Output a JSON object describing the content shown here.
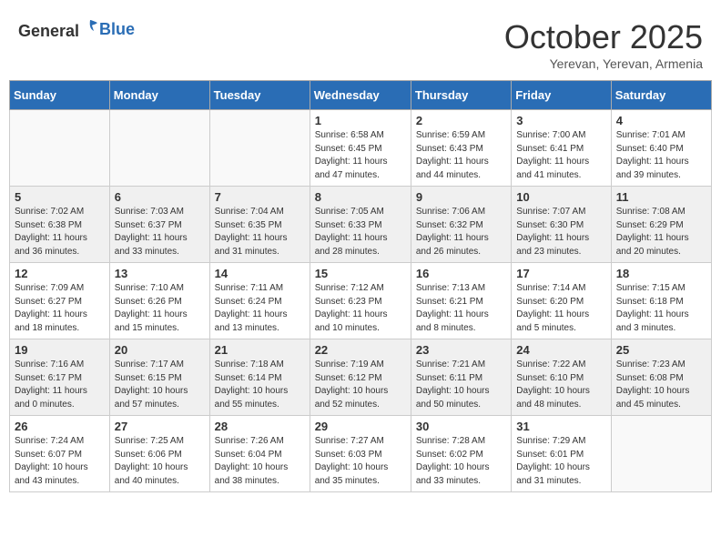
{
  "header": {
    "logo_general": "General",
    "logo_blue": "Blue",
    "month": "October 2025",
    "location": "Yerevan, Yerevan, Armenia"
  },
  "weekdays": [
    "Sunday",
    "Monday",
    "Tuesday",
    "Wednesday",
    "Thursday",
    "Friday",
    "Saturday"
  ],
  "weeks": [
    [
      {
        "day": "",
        "info": ""
      },
      {
        "day": "",
        "info": ""
      },
      {
        "day": "",
        "info": ""
      },
      {
        "day": "1",
        "info": "Sunrise: 6:58 AM\nSunset: 6:45 PM\nDaylight: 11 hours\nand 47 minutes."
      },
      {
        "day": "2",
        "info": "Sunrise: 6:59 AM\nSunset: 6:43 PM\nDaylight: 11 hours\nand 44 minutes."
      },
      {
        "day": "3",
        "info": "Sunrise: 7:00 AM\nSunset: 6:41 PM\nDaylight: 11 hours\nand 41 minutes."
      },
      {
        "day": "4",
        "info": "Sunrise: 7:01 AM\nSunset: 6:40 PM\nDaylight: 11 hours\nand 39 minutes."
      }
    ],
    [
      {
        "day": "5",
        "info": "Sunrise: 7:02 AM\nSunset: 6:38 PM\nDaylight: 11 hours\nand 36 minutes."
      },
      {
        "day": "6",
        "info": "Sunrise: 7:03 AM\nSunset: 6:37 PM\nDaylight: 11 hours\nand 33 minutes."
      },
      {
        "day": "7",
        "info": "Sunrise: 7:04 AM\nSunset: 6:35 PM\nDaylight: 11 hours\nand 31 minutes."
      },
      {
        "day": "8",
        "info": "Sunrise: 7:05 AM\nSunset: 6:33 PM\nDaylight: 11 hours\nand 28 minutes."
      },
      {
        "day": "9",
        "info": "Sunrise: 7:06 AM\nSunset: 6:32 PM\nDaylight: 11 hours\nand 26 minutes."
      },
      {
        "day": "10",
        "info": "Sunrise: 7:07 AM\nSunset: 6:30 PM\nDaylight: 11 hours\nand 23 minutes."
      },
      {
        "day": "11",
        "info": "Sunrise: 7:08 AM\nSunset: 6:29 PM\nDaylight: 11 hours\nand 20 minutes."
      }
    ],
    [
      {
        "day": "12",
        "info": "Sunrise: 7:09 AM\nSunset: 6:27 PM\nDaylight: 11 hours\nand 18 minutes."
      },
      {
        "day": "13",
        "info": "Sunrise: 7:10 AM\nSunset: 6:26 PM\nDaylight: 11 hours\nand 15 minutes."
      },
      {
        "day": "14",
        "info": "Sunrise: 7:11 AM\nSunset: 6:24 PM\nDaylight: 11 hours\nand 13 minutes."
      },
      {
        "day": "15",
        "info": "Sunrise: 7:12 AM\nSunset: 6:23 PM\nDaylight: 11 hours\nand 10 minutes."
      },
      {
        "day": "16",
        "info": "Sunrise: 7:13 AM\nSunset: 6:21 PM\nDaylight: 11 hours\nand 8 minutes."
      },
      {
        "day": "17",
        "info": "Sunrise: 7:14 AM\nSunset: 6:20 PM\nDaylight: 11 hours\nand 5 minutes."
      },
      {
        "day": "18",
        "info": "Sunrise: 7:15 AM\nSunset: 6:18 PM\nDaylight: 11 hours\nand 3 minutes."
      }
    ],
    [
      {
        "day": "19",
        "info": "Sunrise: 7:16 AM\nSunset: 6:17 PM\nDaylight: 11 hours\nand 0 minutes."
      },
      {
        "day": "20",
        "info": "Sunrise: 7:17 AM\nSunset: 6:15 PM\nDaylight: 10 hours\nand 57 minutes."
      },
      {
        "day": "21",
        "info": "Sunrise: 7:18 AM\nSunset: 6:14 PM\nDaylight: 10 hours\nand 55 minutes."
      },
      {
        "day": "22",
        "info": "Sunrise: 7:19 AM\nSunset: 6:12 PM\nDaylight: 10 hours\nand 52 minutes."
      },
      {
        "day": "23",
        "info": "Sunrise: 7:21 AM\nSunset: 6:11 PM\nDaylight: 10 hours\nand 50 minutes."
      },
      {
        "day": "24",
        "info": "Sunrise: 7:22 AM\nSunset: 6:10 PM\nDaylight: 10 hours\nand 48 minutes."
      },
      {
        "day": "25",
        "info": "Sunrise: 7:23 AM\nSunset: 6:08 PM\nDaylight: 10 hours\nand 45 minutes."
      }
    ],
    [
      {
        "day": "26",
        "info": "Sunrise: 7:24 AM\nSunset: 6:07 PM\nDaylight: 10 hours\nand 43 minutes."
      },
      {
        "day": "27",
        "info": "Sunrise: 7:25 AM\nSunset: 6:06 PM\nDaylight: 10 hours\nand 40 minutes."
      },
      {
        "day": "28",
        "info": "Sunrise: 7:26 AM\nSunset: 6:04 PM\nDaylight: 10 hours\nand 38 minutes."
      },
      {
        "day": "29",
        "info": "Sunrise: 7:27 AM\nSunset: 6:03 PM\nDaylight: 10 hours\nand 35 minutes."
      },
      {
        "day": "30",
        "info": "Sunrise: 7:28 AM\nSunset: 6:02 PM\nDaylight: 10 hours\nand 33 minutes."
      },
      {
        "day": "31",
        "info": "Sunrise: 7:29 AM\nSunset: 6:01 PM\nDaylight: 10 hours\nand 31 minutes."
      },
      {
        "day": "",
        "info": ""
      }
    ]
  ]
}
